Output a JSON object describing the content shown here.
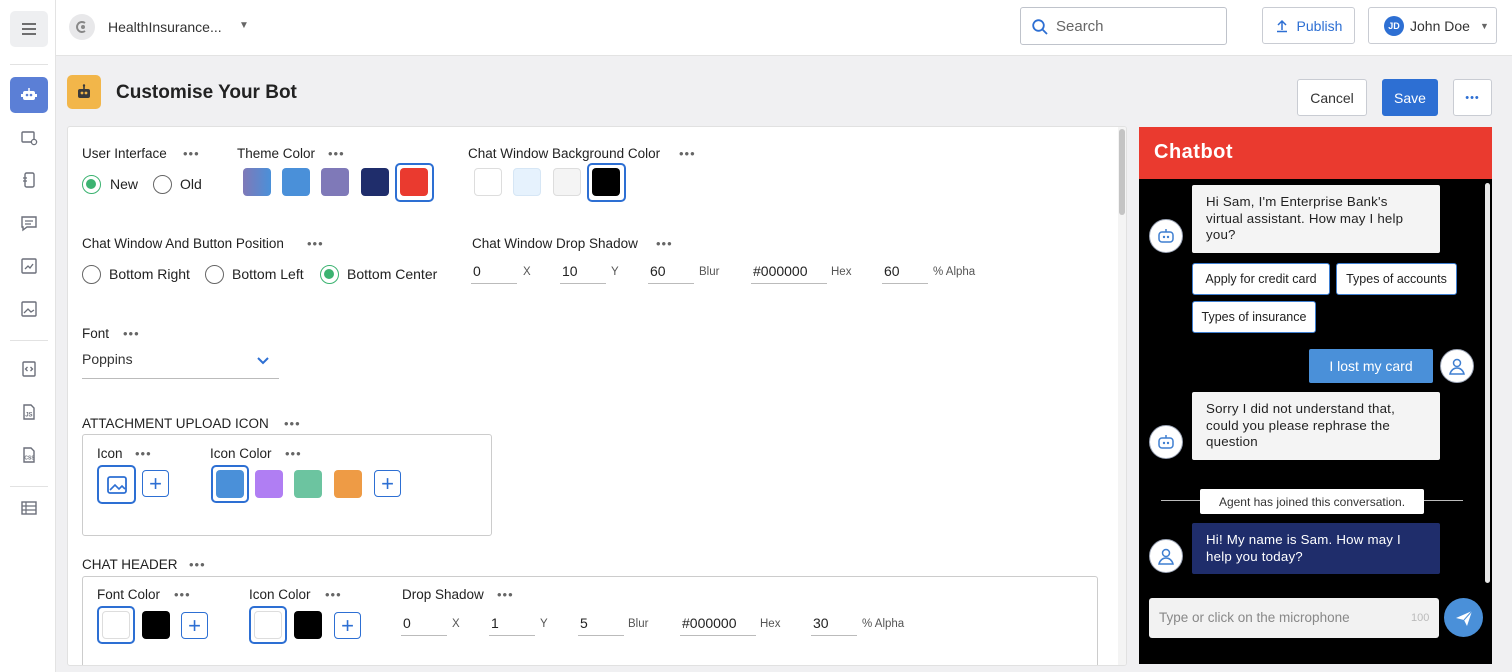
{
  "topbar": {
    "project_name": "HealthInsurance...",
    "search_placeholder": "Search",
    "publish_label": "Publish",
    "user_initials": "JD",
    "user_name": "John Doe"
  },
  "header": {
    "title": "Customise Your Bot",
    "cancel_label": "Cancel",
    "save_label": "Save",
    "more_label": "•••"
  },
  "sidebar": {
    "icons": [
      "menu-icon",
      "bot-icon",
      "settings-icon",
      "mobile-icon",
      "chat-icon",
      "report-icon",
      "image-icon",
      "code-icon",
      "js-icon",
      "css-icon",
      "table-icon"
    ]
  },
  "form": {
    "user_interface": {
      "label": "User Interface",
      "options": [
        "New",
        "Old"
      ],
      "selected": "New"
    },
    "theme_color": {
      "label": "Theme Color",
      "colors": [
        "#6a6fc3",
        "#4a90d9",
        "#7f79b8",
        "#1f2d6b",
        "#ea3a2f"
      ],
      "selected": "#ea3a2f"
    },
    "background_color": {
      "label": "Chat Window Background Color",
      "colors": [
        "#ffffff",
        "#e6f2fd",
        "#f4f4f4",
        "#000000"
      ],
      "selected": "#000000"
    },
    "position": {
      "label": "Chat Window And Button Position",
      "options": [
        "Bottom Right",
        "Bottom Left",
        "Bottom Center"
      ],
      "selected": "Bottom Center"
    },
    "drop_shadow": {
      "label": "Chat Window Drop Shadow",
      "x": "0",
      "x_label": "X",
      "y": "10",
      "y_label": "Y",
      "blur": "60",
      "blur_label": "Blur",
      "hex": "#000000",
      "hex_label": "Hex",
      "alpha": "60",
      "alpha_label": "% Alpha"
    },
    "font": {
      "label": "Font",
      "value": "Poppins"
    },
    "attachment": {
      "label": "ATTACHMENT UPLOAD ICON",
      "icon_label": "Icon",
      "icon_color_label": "Icon Color",
      "colors": [
        "#4a90d9",
        "#b07ef3",
        "#6cc4a0",
        "#ee9b45"
      ]
    },
    "chat_header": {
      "label": "CHAT HEADER",
      "font_color_label": "Font Color",
      "font_colors": [
        "#ffffff",
        "#000000"
      ],
      "icon_color_label": "Icon Color",
      "icon_colors": [
        "#ffffff",
        "#000000"
      ],
      "drop_shadow_label": "Drop Shadow",
      "x": "0",
      "x_label": "X",
      "y": "1",
      "y_label": "Y",
      "blur": "5",
      "blur_label": "Blur",
      "hex": "#000000",
      "hex_label": "Hex",
      "alpha": "30",
      "alpha_label": "% Alpha"
    },
    "more_dots": "•••"
  },
  "chat": {
    "title": "Chatbot",
    "header_color": "#ea3a2f",
    "msg1": "Hi Sam, I'm Enterprise Bank's virtual assistant. How may I help you?",
    "chips": [
      "Apply for credit card",
      "Types of accounts",
      "Types of insurance"
    ],
    "user_msg": "I lost my card",
    "msg2": "Sorry I did not understand that, could you please rephrase the question",
    "agent_joined": "Agent has joined this conversation.",
    "agent_msg": "Hi! My name is Sam. How may I help you today?",
    "input_placeholder": "Type or click on the microphone",
    "char_count": "100"
  }
}
